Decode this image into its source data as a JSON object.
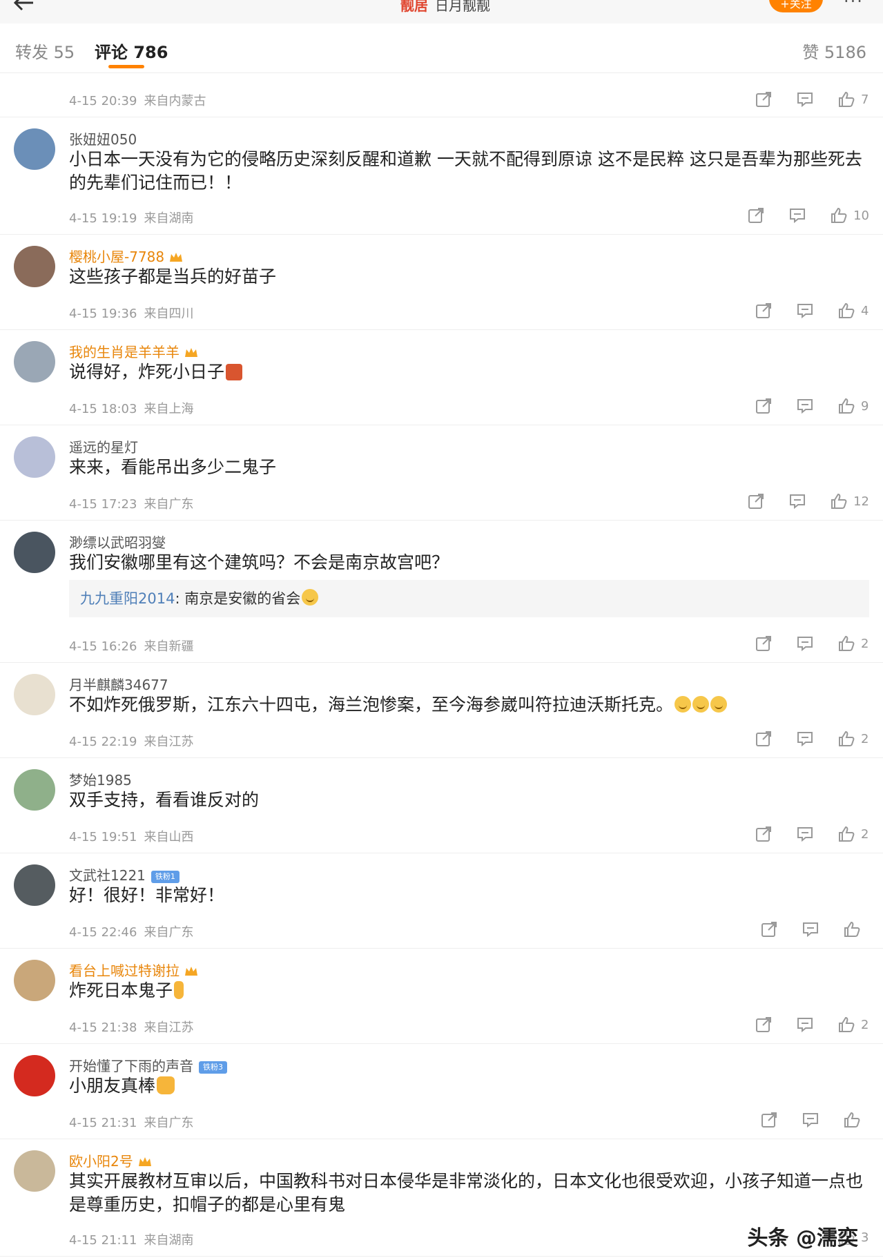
{
  "topbar": {
    "title_mark": "靓居",
    "title": "日月靓靓",
    "follow_label": "+关注",
    "more_label": "···"
  },
  "tabs": [
    {
      "label": "转发 55"
    },
    {
      "label": "评论 786"
    },
    {
      "label": "赞 5186"
    }
  ],
  "comments": [
    {
      "author": "",
      "text": "",
      "time": "4-15 20:39",
      "location": "来自内蒙古",
      "likes": "7"
    },
    {
      "author": "张妞妞050",
      "text": "小日本一天没有为它的侵略历史深刻反醒和道歉 一天就不配得到原谅 这不是民粹 这只是吾辈为那些死去的先辈们记住而已！！",
      "time": "4-15 19:19",
      "location": "来自湖南",
      "likes": "10",
      "avatar_color": "#6b8fb8"
    },
    {
      "author": "樱桃小屋-7788",
      "text": "这些孩子都是当兵的好苗子",
      "time": "4-15 19:36",
      "location": "来自四川",
      "likes": "4",
      "avatar_color": "#8a6b5a"
    },
    {
      "author": "我的生肖是羊羊羊",
      "text": "说得好，炸死小日子",
      "time": "4-15 18:03",
      "location": "来自上海",
      "likes": "9",
      "avatar_color": "#9aa7b5"
    },
    {
      "author": "遥远的星灯",
      "text": "来来，看能吊出多少二鬼子",
      "time": "4-15 17:23",
      "location": "来自广东",
      "likes": "12",
      "avatar_color": "#b8bfd8"
    },
    {
      "author": "渺缥以武昭羽燮",
      "text": "我们安徽哪里有这个建筑吗？不会是南京故宫吧？",
      "reply_author": "九九重阳2014",
      "reply_text": ": 南京是安徽的省会",
      "time": "4-15 16:26",
      "location": "来自新疆",
      "likes": "2",
      "avatar_color": "#4a5560"
    },
    {
      "author": "月半麒麟34677",
      "text": "不如炸死俄罗斯，江东六十四屯，海兰泡惨案，至今海参崴叫符拉迪沃斯托克。",
      "time": "4-15 22:19",
      "location": "来自江苏",
      "likes": "2",
      "avatar_color": "#e8e0d0"
    },
    {
      "author": "梦始1985",
      "text": "双手支持，看看谁反对的",
      "time": "4-15 19:51",
      "location": "来自山西",
      "likes": "2",
      "avatar_color": "#8fb08a"
    },
    {
      "author": "文武社1221",
      "fan_badge": "铁粉1",
      "text": "好！很好！非常好！",
      "time": "4-15 22:46",
      "location": "来自广东",
      "likes": "",
      "avatar_color": "#555c60"
    },
    {
      "author": "看台上喊过特谢拉",
      "text": "炸死日本鬼子",
      "time": "4-15 21:38",
      "location": "来自江苏",
      "likes": "2",
      "avatar_color": "#c9a77a"
    },
    {
      "author": "开始懂了下雨的声音",
      "fan_badge": "铁粉3",
      "text": "小朋友真棒",
      "time": "4-15 21:31",
      "location": "来自广东",
      "likes": "",
      "avatar_color": "#d42a1f"
    },
    {
      "author": "欧小阳2号",
      "text": "其实开展教材互审以后，中国教科书对日本侵华是非常淡化的，日本文化也很受欢迎，小孩子知道一点也是尊重历史，扣帽子的都是心里有鬼",
      "time": "4-15 21:11",
      "location": "来自湖南",
      "likes": "3",
      "avatar_color": "#c9b89a"
    }
  ],
  "watermark": "头条 @濡奕",
  "colors": {
    "accent": "#ff8200",
    "vip_name": "#e8860b",
    "reply_name": "#4f7fb8",
    "meta": "#999999"
  }
}
